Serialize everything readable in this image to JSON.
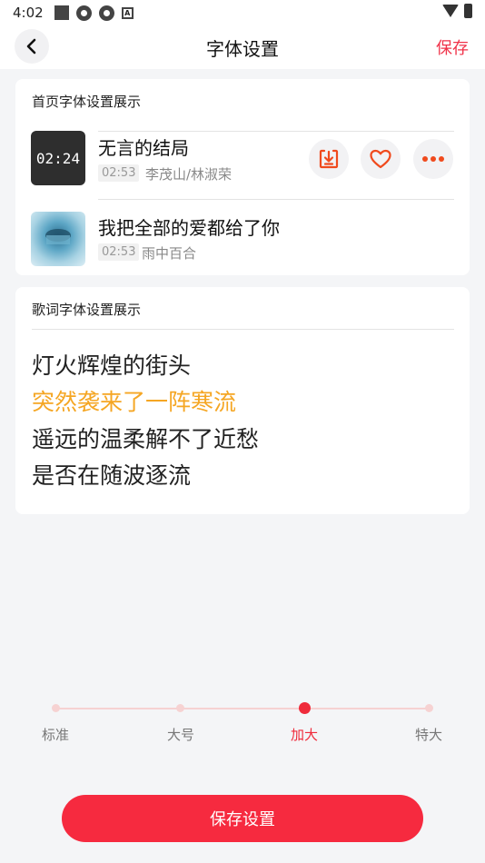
{
  "status_bar": {
    "time": "4:02"
  },
  "header": {
    "title": "字体设置",
    "save_label": "保存"
  },
  "home_preview": {
    "title": "首页字体设置展示",
    "songs": [
      {
        "title": "无言的结局",
        "duration": "02:53",
        "artist": "李茂山/林淑荣",
        "cover_text": "02:24"
      },
      {
        "title": "我把全部的爱都给了你",
        "duration": "02:53",
        "artist": "雨中百合"
      }
    ]
  },
  "lyrics_preview": {
    "title": "歌词字体设置展示",
    "lines": [
      "灯火辉煌的街头",
      "突然袭来了一阵寒流",
      "遥远的温柔解不了近愁",
      "是否在随波逐流"
    ],
    "active_line_index": 1
  },
  "font_size": {
    "options": [
      "标准",
      "大号",
      "加大",
      "特大"
    ],
    "selected_index": 2
  },
  "save_button": {
    "label": "保存设置"
  },
  "colors": {
    "accent": "#f62a3f",
    "lyric_highlight": "#f5a623",
    "action_icon": "#f04a1d"
  }
}
